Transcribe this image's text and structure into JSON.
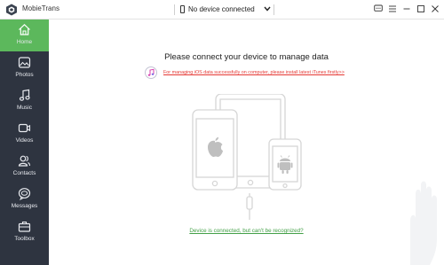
{
  "app": {
    "title": "MobieTrans"
  },
  "device_selector": {
    "value": "No device connected"
  },
  "window_controls": [
    "feedback-icon",
    "menu-icon",
    "minimize-icon",
    "maximize-icon",
    "close-icon"
  ],
  "sidebar": {
    "active": "Home",
    "items": [
      {
        "label": "Home",
        "icon": "home-icon"
      },
      {
        "label": "Photos",
        "icon": "photos-icon"
      },
      {
        "label": "Music",
        "icon": "music-icon"
      },
      {
        "label": "Videos",
        "icon": "videos-icon"
      },
      {
        "label": "Contacts",
        "icon": "contacts-icon"
      },
      {
        "label": "Messages",
        "icon": "messages-icon"
      },
      {
        "label": "Toolbox",
        "icon": "toolbox-icon"
      }
    ]
  },
  "main": {
    "title": "Please connect your device to manage data",
    "itunes_notice": "For managing iOS data successfully on computer, please install latest iTunes firstly>>",
    "help_link": "Device is connected, but can't be recognized?"
  },
  "colors": {
    "sidebar_bg": "#2e3440",
    "active_green": "#5cb85c",
    "notice_red": "#e53935",
    "link_green": "#43a047"
  }
}
